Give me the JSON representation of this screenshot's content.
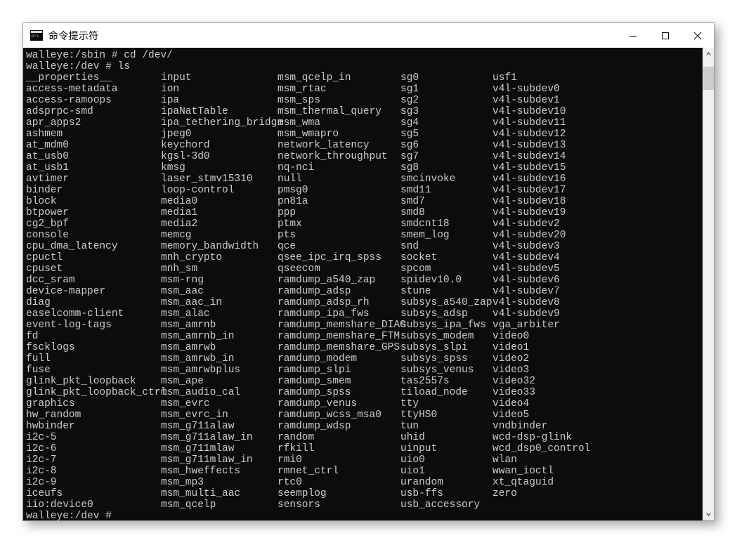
{
  "window": {
    "title": "命令提示符",
    "icon": "console-icon",
    "controls": [
      {
        "name": "minimize-button",
        "glyph": "minimize-icon"
      },
      {
        "name": "maximize-button",
        "glyph": "maximize-icon"
      },
      {
        "name": "close-button",
        "glyph": "close-icon"
      }
    ]
  },
  "console": {
    "background": "#0c0c0c",
    "foreground": "#cccccc",
    "prompt_line_1": "walleye:/sbin # cd /dev/",
    "prompt_line_2": "walleye:/dev # ls",
    "prompt_line_last": "walleye:/dev #",
    "columns": [
      {
        "name": "column-1",
        "entries": [
          "__properties__",
          "access-metadata",
          "access-ramoops",
          "adsprpc-smd",
          "apr_apps2",
          "ashmem",
          "at_mdm0",
          "at_usb0",
          "at_usb1",
          "avtimer",
          "binder",
          "block",
          "btpower",
          "cg2_bpf",
          "console",
          "cpu_dma_latency",
          "cpuctl",
          "cpuset",
          "dcc_sram",
          "device-mapper",
          "diag",
          "easelcomm-client",
          "event-log-tags",
          "fd",
          "fscklogs",
          "full",
          "fuse",
          "glink_pkt_loopback",
          "glink_pkt_loopback_ctrl",
          "graphics",
          "hw_random",
          "hwbinder",
          "i2c-5",
          "i2c-6",
          "i2c-7",
          "i2c-8",
          "i2c-9",
          "iceufs",
          "iio:device0"
        ]
      },
      {
        "name": "column-2",
        "entries": [
          "input",
          "ion",
          "ipa",
          "ipaNatTable",
          "ipa_tethering_bridge",
          "jpeg0",
          "keychord",
          "kgsl-3d0",
          "kmsg",
          "laser_stmv15310",
          "loop-control",
          "media0",
          "media1",
          "media2",
          "memcg",
          "memory_bandwidth",
          "mnh_crypto",
          "mnh_sm",
          "msm-rng",
          "msm_aac",
          "msm_aac_in",
          "msm_alac",
          "msm_amrnb",
          "msm_amrnb_in",
          "msm_amrwb",
          "msm_amrwb_in",
          "msm_amrwbplus",
          "msm_ape",
          "msm_audio_cal",
          "msm_evrc",
          "msm_evrc_in",
          "msm_g711alaw",
          "msm_g711alaw_in",
          "msm_g711mlaw",
          "msm_g711mlaw_in",
          "msm_hweffects",
          "msm_mp3",
          "msm_multi_aac",
          "msm_qcelp"
        ]
      },
      {
        "name": "column-3",
        "entries": [
          "msm_qcelp_in",
          "msm_rtac",
          "msm_sps",
          "msm_thermal_query",
          "msm_wma",
          "msm_wmapro",
          "network_latency",
          "network_throughput",
          "nq-nci",
          "null",
          "pmsg0",
          "pn81a",
          "ppp",
          "ptmx",
          "pts",
          "qce",
          "qsee_ipc_irq_spss",
          "qseecom",
          "ramdump_a540_zap",
          "ramdump_adsp",
          "ramdump_adsp_rh",
          "ramdump_ipa_fws",
          "ramdump_memshare_DIAG",
          "ramdump_memshare_FTM",
          "ramdump_memshare_GPS",
          "ramdump_modem",
          "ramdump_slpi",
          "ramdump_smem",
          "ramdump_spss",
          "ramdump_venus",
          "ramdump_wcss_msa0",
          "ramdump_wdsp",
          "random",
          "rfkill",
          "rmi0",
          "rmnet_ctrl",
          "rtc0",
          "seemplog",
          "sensors"
        ]
      },
      {
        "name": "column-4",
        "entries": [
          "sg0",
          "sg1",
          "sg2",
          "sg3",
          "sg4",
          "sg5",
          "sg6",
          "sg7",
          "sg8",
          "smcinvoke",
          "smd11",
          "smd7",
          "smd8",
          "smdcnt18",
          "smem_log",
          "snd",
          "socket",
          "spcom",
          "spidev10.0",
          "stune",
          "subsys_a540_zap",
          "subsys_adsp",
          "subsys_ipa_fws",
          "subsys_modem",
          "subsys_slpi",
          "subsys_spss",
          "subsys_venus",
          "tas2557s",
          "tiload_node",
          "tty",
          "ttyHS0",
          "tun",
          "uhid",
          "uinput",
          "uio0",
          "uio1",
          "urandom",
          "usb-ffs",
          "usb_accessory"
        ]
      },
      {
        "name": "column-5",
        "entries": [
          "usf1",
          "v4l-subdev0",
          "v4l-subdev1",
          "v4l-subdev10",
          "v4l-subdev11",
          "v4l-subdev12",
          "v4l-subdev13",
          "v4l-subdev14",
          "v4l-subdev15",
          "v4l-subdev16",
          "v4l-subdev17",
          "v4l-subdev18",
          "v4l-subdev19",
          "v4l-subdev2",
          "v4l-subdev20",
          "v4l-subdev3",
          "v4l-subdev4",
          "v4l-subdev5",
          "v4l-subdev6",
          "v4l-subdev7",
          "v4l-subdev8",
          "v4l-subdev9",
          "vga_arbiter",
          "video0",
          "video1",
          "video2",
          "video3",
          "video32",
          "video33",
          "video4",
          "video5",
          "vndbinder",
          "wcd-dsp-glink",
          "wcd_dsp0_control",
          "wlan",
          "wwan_ioctl",
          "xt_qtaguid",
          "zero"
        ]
      }
    ]
  },
  "scrollbar": {
    "up_arrow": "chevron-up-icon",
    "down_arrow": "chevron-down-icon"
  }
}
